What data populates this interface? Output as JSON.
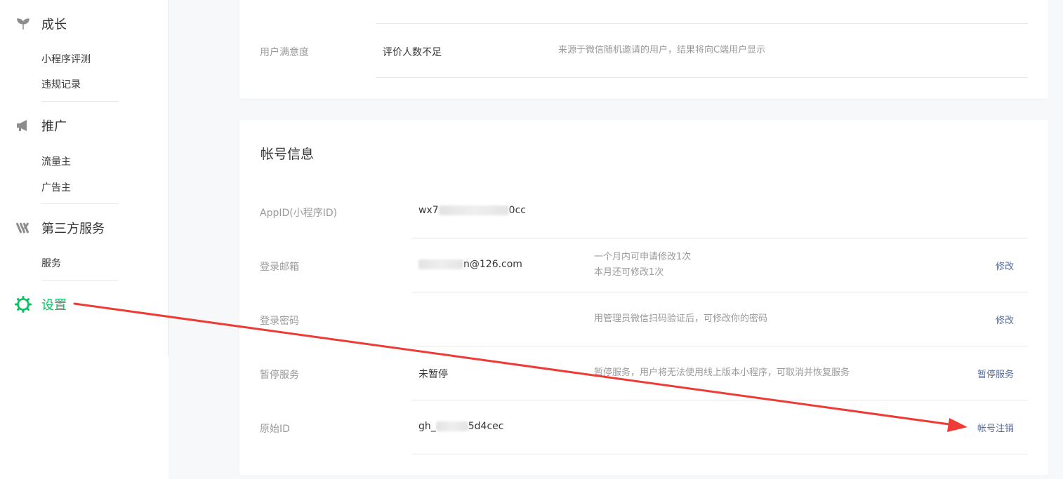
{
  "sidebar": {
    "sections": [
      {
        "label": "成长",
        "icon": "sprout-icon",
        "items": [
          "小程序评测",
          "违规记录"
        ]
      },
      {
        "label": "推广",
        "icon": "megaphone-icon",
        "items": [
          "流量主",
          "广告主"
        ]
      },
      {
        "label": "第三方服务",
        "icon": "third-party-service-icon",
        "items": [
          "服务"
        ]
      },
      {
        "label": "设置",
        "icon": "gear-icon",
        "items": []
      }
    ]
  },
  "quality_card": {
    "satisfaction": {
      "label": "用户满意度",
      "value": "评价人数不足",
      "desc": "来源于微信随机邀请的用户，结果将向C端用户显示"
    }
  },
  "account_card": {
    "title": "帐号信息",
    "appid": {
      "label": "AppID(小程序ID)",
      "value_start": "wx7",
      "value_end": "0cc"
    },
    "email": {
      "label": "登录邮箱",
      "value_end": "n@126.com",
      "desc_line1": "一个月内可申请修改1次",
      "desc_line2": "本月还可修改1次",
      "action": "修改"
    },
    "password": {
      "label": "登录密码",
      "desc": "用管理员微信扫码验证后，可修改你的密码",
      "action": "修改"
    },
    "pause": {
      "label": "暂停服务",
      "value": "未暂停",
      "desc": "暂停服务，用户将无法使用线上版本小程序，可取消并恢复服务",
      "action": "暂停服务"
    },
    "origin_id": {
      "label": "原始ID",
      "value_start": "gh_",
      "value_end": "5d4cec",
      "action": "帐号注销"
    }
  },
  "colors": {
    "accent_green": "#07c160",
    "link_blue": "#576b95",
    "arrow_red": "#ef3b36"
  }
}
